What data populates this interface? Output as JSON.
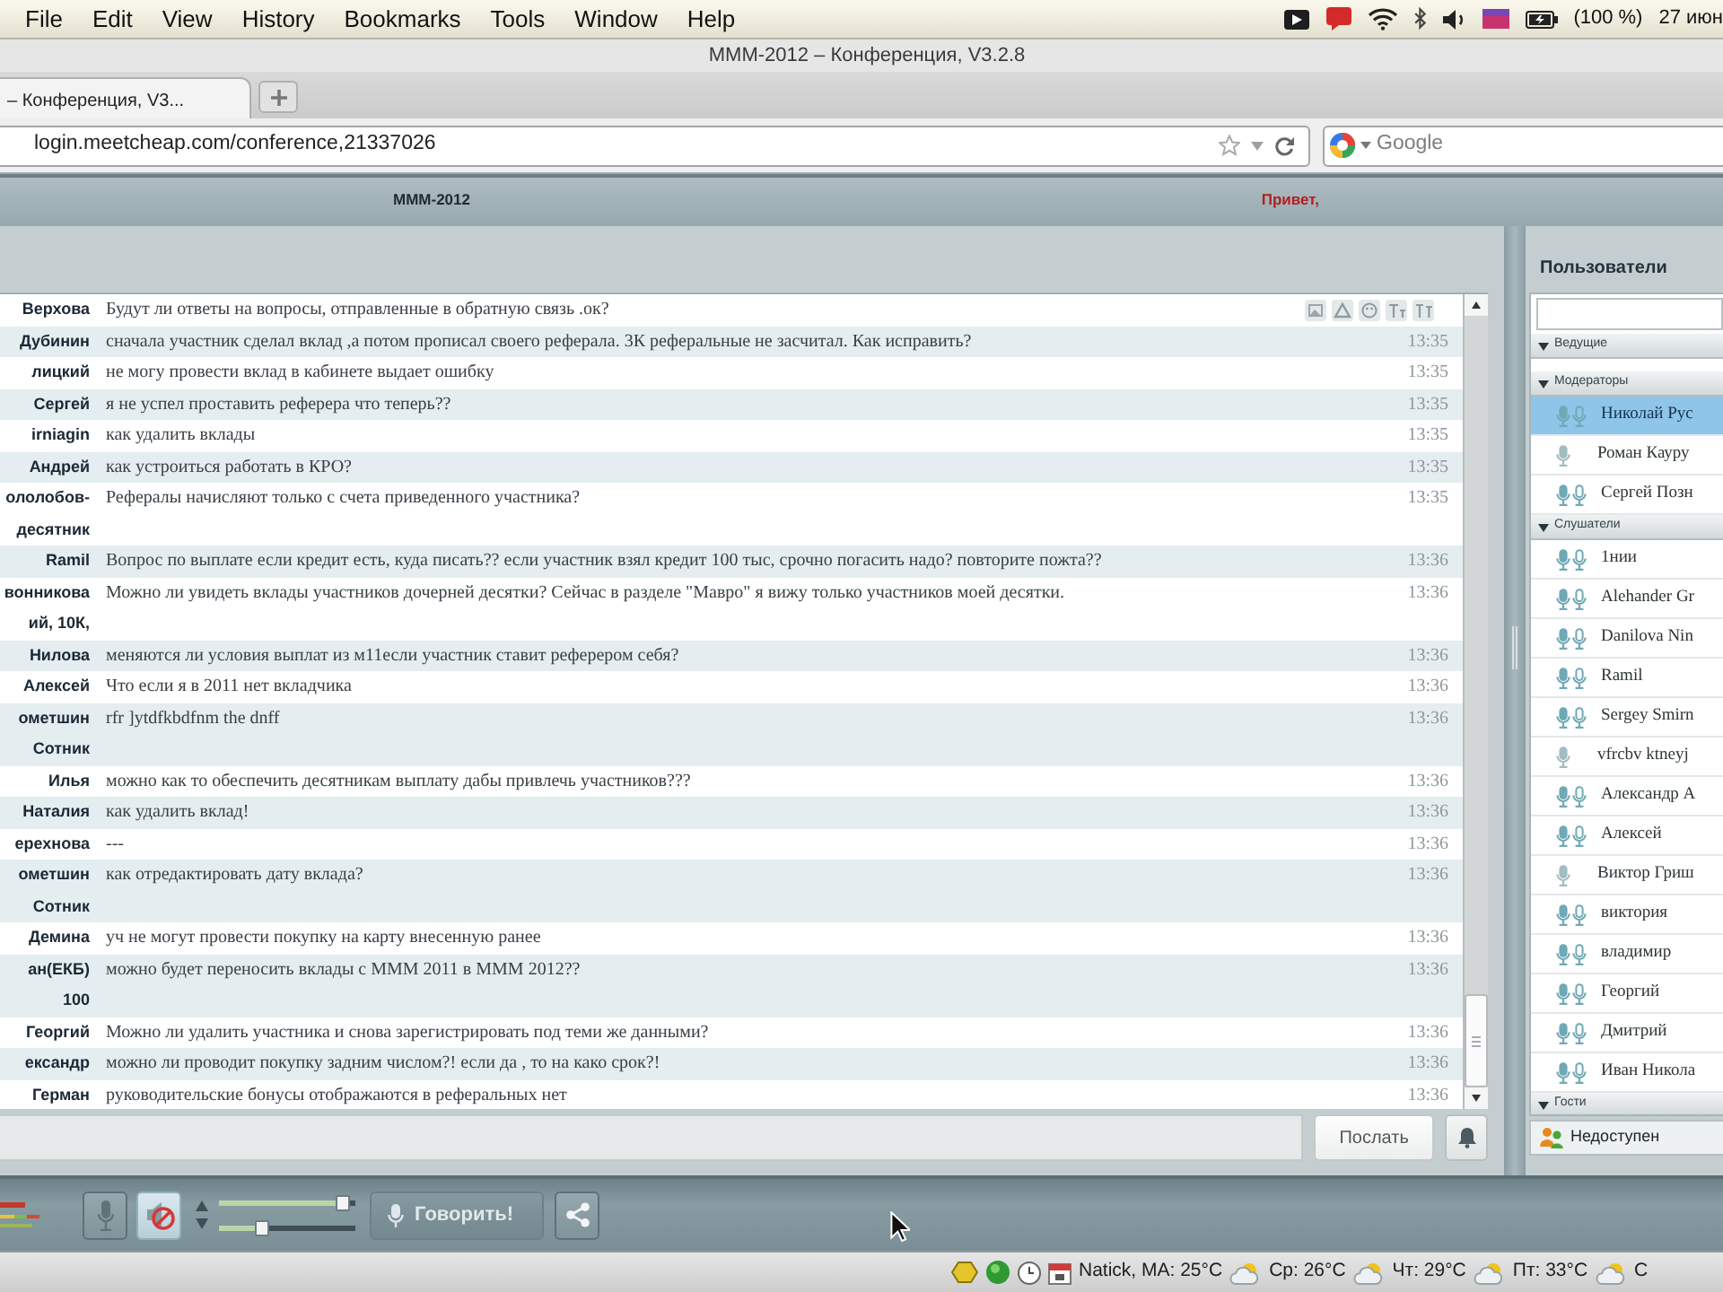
{
  "menubar": {
    "items": [
      "File",
      "Edit",
      "View",
      "History",
      "Bookmarks",
      "Tools",
      "Window",
      "Help"
    ],
    "battery": "(100 %)",
    "date": "27 июн"
  },
  "browser": {
    "title": "МММ-2012 – Конференция, V3.2.8",
    "tabs": [
      {
        "label": "– Конференция, V3...",
        "selected": true
      }
    ],
    "url": "login.meetcheap.com/conference,21337026",
    "search": {
      "placeholder": "Google"
    }
  },
  "app_header": {
    "title": "МММ-2012",
    "greeting": "Привет,"
  },
  "chat": {
    "messages": [
      {
        "author": "Верхова",
        "text": "Будут ли ответы на вопросы, отправленные в обратную связь .ок?"
      },
      {
        "author": "Дубинин",
        "text": "сначала участник сделал вклад ,а потом прописал своего реферала. 3К реферальные не засчитал. Как исправить?",
        "time": "13:35"
      },
      {
        "author": "лицкий",
        "text": "не могу провести вклад в кабинете выдает ошибку",
        "time": "13:35"
      },
      {
        "author": "Сергей",
        "text": "я не успел проставить реферера что теперь??",
        "time": "13:35"
      },
      {
        "author": "irniagin",
        "text": "как удалить вклады",
        "time": "13:35"
      },
      {
        "author": "Андрей",
        "text": "как устроиться работать в КРО?",
        "time": "13:35"
      },
      {
        "author": "ололобов-десятник",
        "text": "Рефералы начисляют только с счета приведенного участника?",
        "time": "13:35"
      },
      {
        "author": "Ramil",
        "text": "Вопрос по выплате если кредит есть, куда писать?? если участник взял кредит 100 тыс, срочно погасить надо? повторите пожта??",
        "time": "13:36"
      },
      {
        "author": "вонникова ий, 10К,",
        "text": "Можно ли увидеть вклады участников дочерней десятки? Сейчас в разделе \"Мавро\" я вижу только участников моей десятки.",
        "time": "13:36"
      },
      {
        "author": "Нилова",
        "text": "меняются ли условия выплат из м11если участник ставит реферером себя?",
        "time": "13:36"
      },
      {
        "author": "Алексей",
        "text": "Что если я в 2011 нет вкладчика",
        "time": "13:36"
      },
      {
        "author": "ометшин Сотник",
        "text": "rfr ]ytdfkbdfnm the dnff",
        "time": "13:36"
      },
      {
        "author": "Илья",
        "text": "можно как то обеспечить десятникам выплату дабы привлечь участников???",
        "time": "13:36"
      },
      {
        "author": "Наталия",
        "text": "как удалить вклад!",
        "time": "13:36"
      },
      {
        "author": "ерехнова",
        "text": "---",
        "time": "13:36"
      },
      {
        "author": "ометшин Сотник",
        "text": "как отредактировать дату вклада?",
        "time": "13:36"
      },
      {
        "author": "Демина",
        "text": "уч не могут провести покупку на карту внесенную ранее",
        "time": "13:36"
      },
      {
        "author": "ан(ЕКБ) 100",
        "text": "можно будет переносить вклады с МММ 2011 в МММ 2012??",
        "time": "13:36"
      },
      {
        "author": "Георгий",
        "text": "Можно ли удалить участника и снова зарегистрировать под теми же данными?",
        "time": "13:36"
      },
      {
        "author": "ександр",
        "text": "можно ли проводит покупку задним числом?! если да , то на како срок?!",
        "time": "13:36"
      },
      {
        "author": "Герман",
        "text": "руководительские бонусы отображаются в реферальных нет",
        "time": "13:36"
      }
    ],
    "send_button": "Послать"
  },
  "users": {
    "title": "Пользователи",
    "groups": [
      {
        "label": "Ведущие",
        "expanded": true
      },
      {
        "label": "Модераторы",
        "expanded": true,
        "users": [
          {
            "name": "Николай Рус",
            "kind": "pair",
            "selected": true
          },
          {
            "name": "Роман Кауру",
            "kind": "single",
            "selected": false
          },
          {
            "name": "Сергей Позн",
            "kind": "pair",
            "selected": false
          }
        ]
      },
      {
        "label": "Слушатели",
        "expanded": true,
        "users": [
          {
            "name": "1нии",
            "kind": "pair",
            "selected": false
          },
          {
            "name": "Alehander Gr",
            "kind": "pair",
            "selected": false
          },
          {
            "name": "Danilova Nin",
            "kind": "pair",
            "selected": false
          },
          {
            "name": "Ramil",
            "kind": "pair",
            "selected": false
          },
          {
            "name": "Sergey Smirn",
            "kind": "pair",
            "selected": false
          },
          {
            "name": "vfrcbv ktneyj",
            "kind": "single",
            "selected": false
          },
          {
            "name": "Александр А",
            "kind": "pair",
            "selected": false
          },
          {
            "name": "Алексей",
            "kind": "pair",
            "selected": false
          },
          {
            "name": "Виктор Гриш",
            "kind": "single",
            "selected": false
          },
          {
            "name": "виктория",
            "kind": "pair",
            "selected": false
          },
          {
            "name": "владимир",
            "kind": "pair",
            "selected": false
          },
          {
            "name": "Георгий",
            "kind": "pair",
            "selected": false
          },
          {
            "name": "Дмитрий",
            "kind": "pair",
            "selected": false
          },
          {
            "name": "Иван Никола",
            "kind": "pair",
            "selected": false
          }
        ]
      },
      {
        "label": "Гости",
        "expanded": true
      }
    ],
    "status": "Недоступен"
  },
  "toolbar": {
    "buttons": [
      {
        "kind": "microphone",
        "pressed": false
      },
      {
        "kind": "speaker",
        "pressed": true
      }
    ],
    "sliders": [
      {
        "level": 0.95
      },
      {
        "level": 0.3
      }
    ],
    "speak_button": {
      "label": "Говорить!",
      "disabled": true
    }
  },
  "status_bar": {
    "weather": [
      "Natick, MA: 25°C",
      "Ср: 26°C",
      "Чт: 29°C",
      "Пт: 33°C",
      "С"
    ]
  }
}
